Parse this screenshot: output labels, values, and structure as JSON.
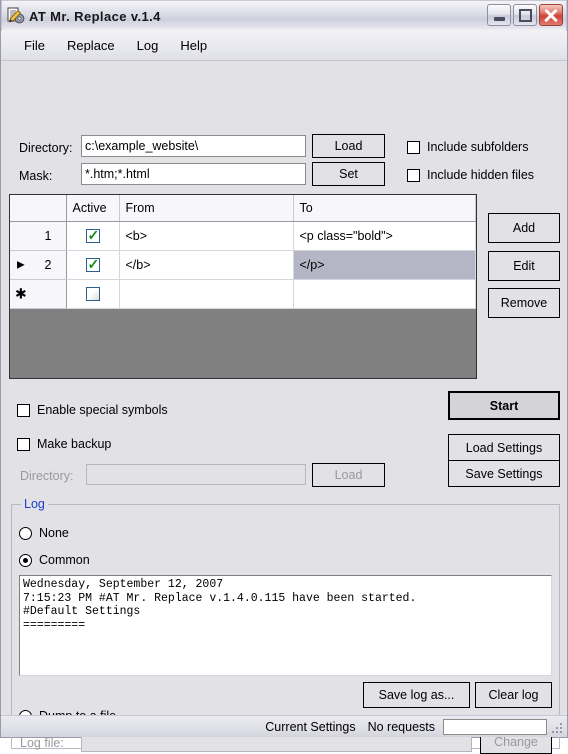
{
  "window": {
    "title": "AT Mr. Replace v.1.4",
    "icon": "document-pencil-gear-icon",
    "minimize_label": "Minimize",
    "maximize_label": "Maximize",
    "close_label": "Close"
  },
  "menubar": {
    "items": [
      {
        "label": "File"
      },
      {
        "label": "Replace"
      },
      {
        "label": "Log"
      },
      {
        "label": "Help"
      }
    ]
  },
  "source": {
    "directory_label": "Directory:",
    "directory_value": "c:\\example_website\\",
    "directory_placeholder": "",
    "load_button": "Load",
    "mask_label": "Mask:",
    "mask_value": "*.htm;*.html",
    "mask_placeholder": "",
    "set_button": "Set",
    "include_subfolders": {
      "label": "Include subfolders",
      "checked": false
    },
    "include_hidden_files": {
      "label": "Include hidden files",
      "checked": false
    }
  },
  "grid": {
    "columns": [
      "",
      "Active",
      "From",
      "To"
    ],
    "rows": [
      {
        "num": "1",
        "marker": "",
        "active": true,
        "from": "<b>",
        "to": "<p class=\"bold\">",
        "selected": false
      },
      {
        "num": "2",
        "marker": "▶",
        "active": true,
        "from": "</b>",
        "to": "</p>",
        "selected": true
      },
      {
        "num": "",
        "marker": "✱",
        "active": false,
        "from": "",
        "to": "",
        "selected": false
      }
    ]
  },
  "grid_buttons": {
    "add": "Add",
    "edit": "Edit",
    "remove": "Remove"
  },
  "options": {
    "enable_special_symbols": {
      "label": "Enable special symbols",
      "checked": false
    },
    "make_backup": {
      "label": "Make backup",
      "checked": false
    },
    "backup_directory_label": "Directory:",
    "backup_directory_value": "",
    "backup_load_button": "Load"
  },
  "actions": {
    "start": "Start",
    "load_settings": "Load Settings",
    "save_settings": "Save Settings"
  },
  "log": {
    "group_label": "Log",
    "mode_none": {
      "label": "None",
      "selected": false
    },
    "mode_common": {
      "label": "Common",
      "selected": true
    },
    "mode_dump": {
      "label": "Dump to a file",
      "selected": false
    },
    "text": "Wednesday, September 12, 2007\n7:15:23 PM #AT Mr. Replace v.1.4.0.115 have been started.\n#Default Settings\n=========",
    "save_log_button": "Save log as...",
    "clear_log_button": "Clear log",
    "logfile_label": "Log file:",
    "logfile_value": "",
    "change_button": "Change"
  },
  "statusbar": {
    "settings_text": "Current Settings",
    "requests_text": "No requests",
    "field_value": ""
  },
  "colors": {
    "group_label": "#1a3ecb",
    "selection": "#b4b6c6",
    "checkmark": "#1a8a1a",
    "grid_backdrop": "#808080",
    "face": "#e2e2e6"
  }
}
